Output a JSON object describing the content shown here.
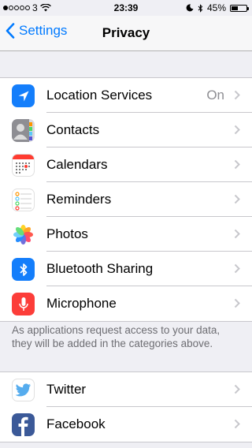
{
  "status": {
    "carrier": "3",
    "time": "23:39",
    "battery": "45%",
    "battery_level": 0.45,
    "signal_bars_full": 1,
    "signal_bars_total": 5
  },
  "nav": {
    "back_label": "Settings",
    "title": "Privacy"
  },
  "privacy_items": [
    {
      "label": "Location Services",
      "value": "On",
      "icon": "location-arrow-icon",
      "color": "#147efb"
    },
    {
      "label": "Contacts",
      "icon": "contacts-icon",
      "color": "#8e8e93"
    },
    {
      "label": "Calendars",
      "icon": "calendar-icon",
      "color": "#ff3b30"
    },
    {
      "label": "Reminders",
      "icon": "reminders-icon",
      "color": "#ffffff"
    },
    {
      "label": "Photos",
      "icon": "photos-icon",
      "color": "#ffffff"
    },
    {
      "label": "Bluetooth Sharing",
      "icon": "bluetooth-icon",
      "color": "#147efb"
    },
    {
      "label": "Microphone",
      "icon": "microphone-icon",
      "color": "#fc3d39"
    }
  ],
  "footer_note": "As applications request access to your data, they will be added in the categories above.",
  "social_items": [
    {
      "label": "Twitter",
      "icon": "twitter-bird-icon",
      "color": "#55acee"
    },
    {
      "label": "Facebook",
      "icon": "facebook-f-icon",
      "color": "#3b5998"
    }
  ],
  "colors": {
    "accent": "#007aff",
    "background": "#efeff4",
    "separator": "#c8c7cc"
  }
}
